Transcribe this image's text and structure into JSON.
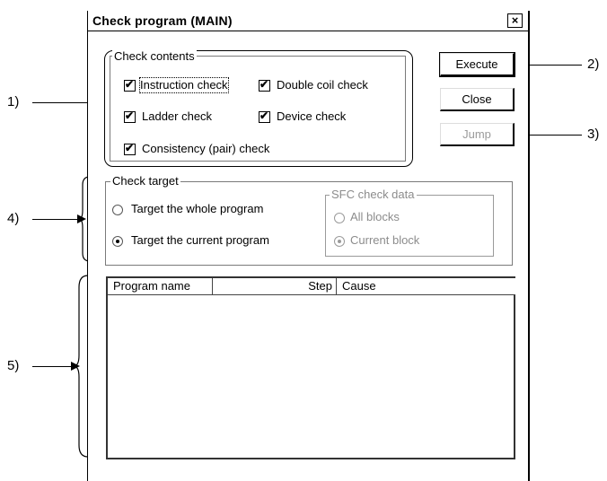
{
  "window": {
    "title": "Check program (MAIN)",
    "close_symbol": "×"
  },
  "check_contents": {
    "legend": "Check contents",
    "items": [
      {
        "label": "Instruction check",
        "checked": true
      },
      {
        "label": "Double coil check",
        "checked": true
      },
      {
        "label": "Ladder check",
        "checked": true
      },
      {
        "label": "Device check",
        "checked": true
      },
      {
        "label": "Consistency (pair) check",
        "checked": true
      }
    ]
  },
  "buttons": {
    "execute": "Execute",
    "close": "Close",
    "jump": "Jump"
  },
  "check_target": {
    "legend": "Check target",
    "options": [
      {
        "label": "Target the whole program",
        "selected": false
      },
      {
        "label": "Target the current program",
        "selected": true
      }
    ]
  },
  "sfc_check_data": {
    "legend": "SFC check data",
    "options": [
      {
        "label": "All blocks",
        "selected": false
      },
      {
        "label": "Current block",
        "selected": true
      }
    ]
  },
  "results_table": {
    "columns": [
      "Program name",
      "Step",
      "Cause"
    ],
    "rows": []
  },
  "callouts": {
    "c1": "1)",
    "c2": "2)",
    "c3": "3)",
    "c4": "4)",
    "c5": "5)"
  }
}
